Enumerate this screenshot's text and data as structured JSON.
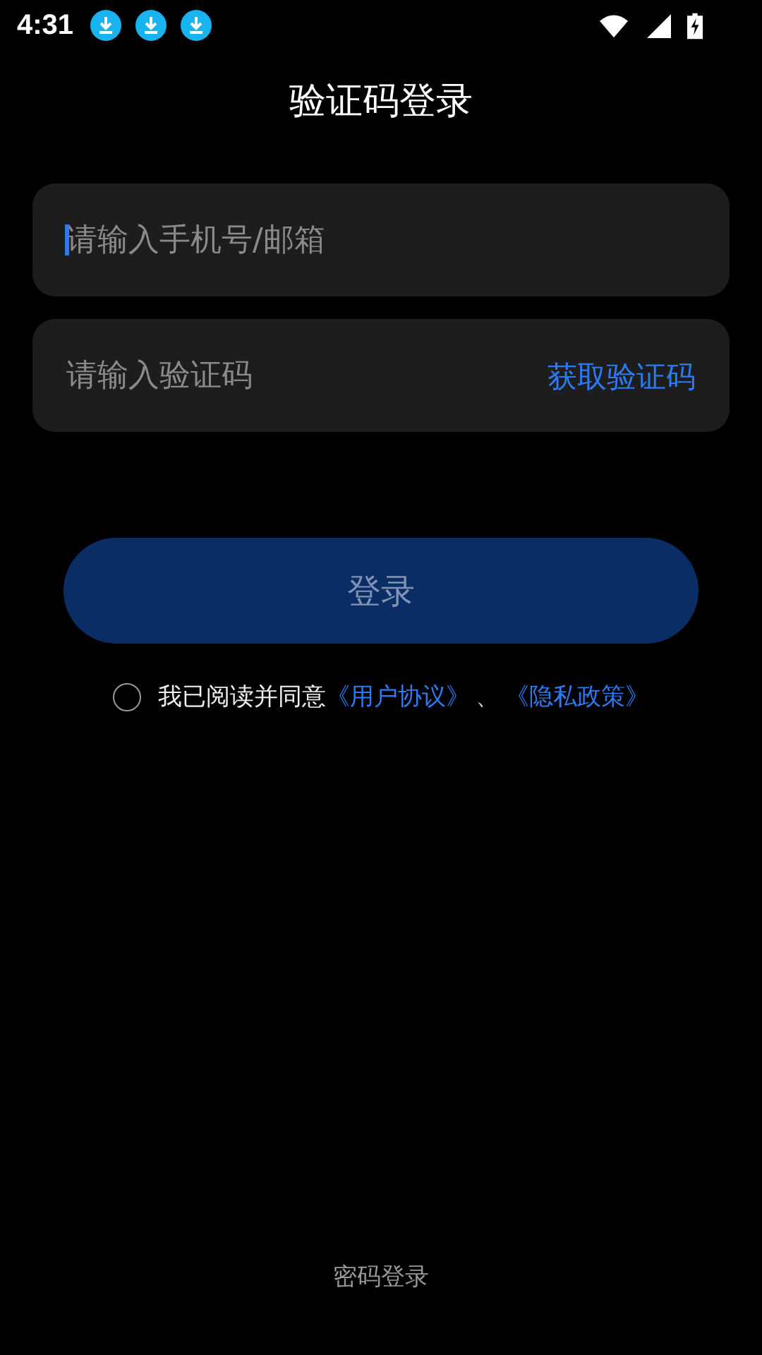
{
  "status_bar": {
    "time": "4:31",
    "notifications": [
      {
        "kind": "download"
      },
      {
        "kind": "download"
      },
      {
        "kind": "download"
      }
    ]
  },
  "title": "验证码登录",
  "phone_field": {
    "placeholder": "请输入手机号/邮箱",
    "focused": true
  },
  "code_field": {
    "placeholder": "请输入验证码",
    "action": "获取验证码"
  },
  "login_button": {
    "label": "登录",
    "disabled": true
  },
  "agreement": {
    "checked": false,
    "text": "我已阅读并同意",
    "links": [
      "《用户协议》",
      "《隐私政策》"
    ],
    "separator": "、"
  },
  "alt_login": "密码登录"
}
